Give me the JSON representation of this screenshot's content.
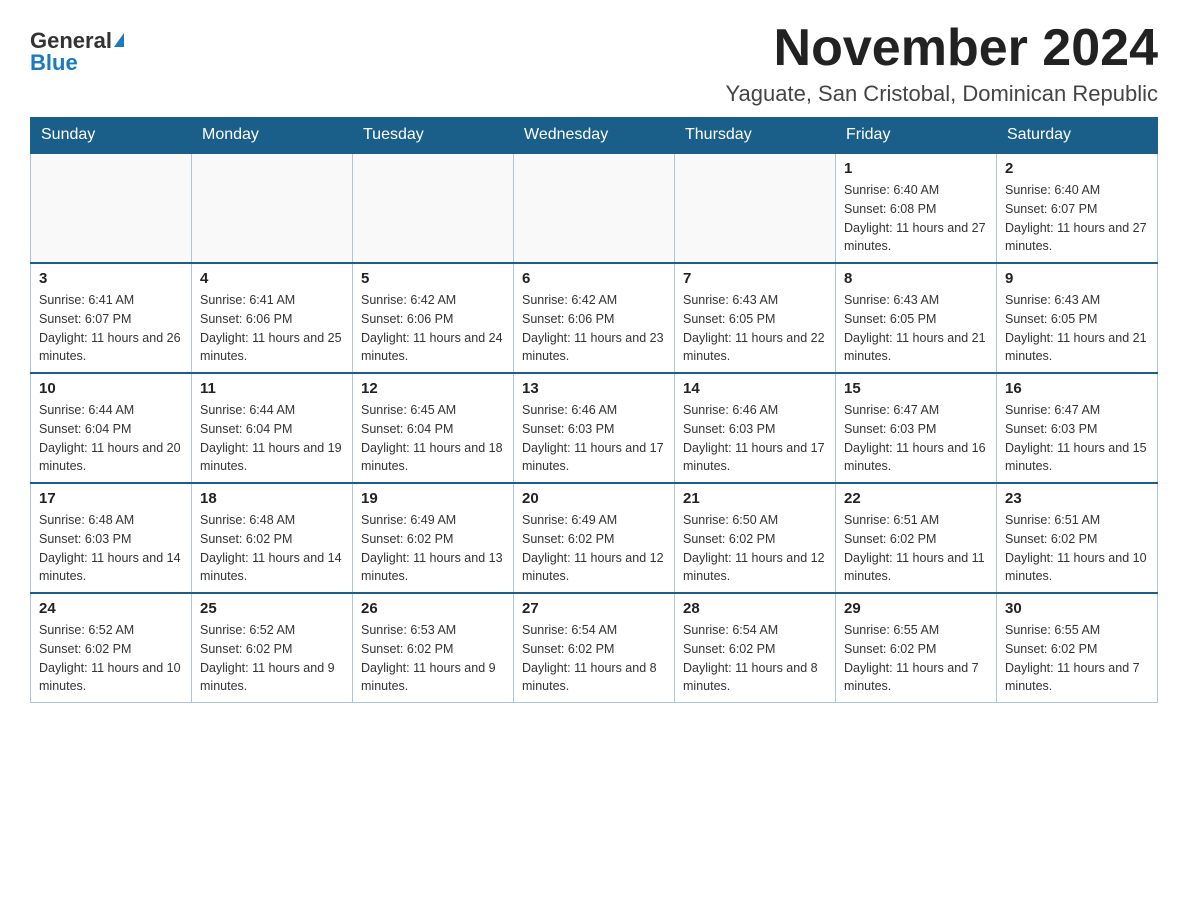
{
  "header": {
    "logo_general": "General",
    "logo_blue": "Blue",
    "month_title": "November 2024",
    "location": "Yaguate, San Cristobal, Dominican Republic"
  },
  "days_of_week": [
    "Sunday",
    "Monday",
    "Tuesday",
    "Wednesday",
    "Thursday",
    "Friday",
    "Saturday"
  ],
  "weeks": [
    [
      {
        "day": "",
        "info": ""
      },
      {
        "day": "",
        "info": ""
      },
      {
        "day": "",
        "info": ""
      },
      {
        "day": "",
        "info": ""
      },
      {
        "day": "",
        "info": ""
      },
      {
        "day": "1",
        "info": "Sunrise: 6:40 AM\nSunset: 6:08 PM\nDaylight: 11 hours and 27 minutes."
      },
      {
        "day": "2",
        "info": "Sunrise: 6:40 AM\nSunset: 6:07 PM\nDaylight: 11 hours and 27 minutes."
      }
    ],
    [
      {
        "day": "3",
        "info": "Sunrise: 6:41 AM\nSunset: 6:07 PM\nDaylight: 11 hours and 26 minutes."
      },
      {
        "day": "4",
        "info": "Sunrise: 6:41 AM\nSunset: 6:06 PM\nDaylight: 11 hours and 25 minutes."
      },
      {
        "day": "5",
        "info": "Sunrise: 6:42 AM\nSunset: 6:06 PM\nDaylight: 11 hours and 24 minutes."
      },
      {
        "day": "6",
        "info": "Sunrise: 6:42 AM\nSunset: 6:06 PM\nDaylight: 11 hours and 23 minutes."
      },
      {
        "day": "7",
        "info": "Sunrise: 6:43 AM\nSunset: 6:05 PM\nDaylight: 11 hours and 22 minutes."
      },
      {
        "day": "8",
        "info": "Sunrise: 6:43 AM\nSunset: 6:05 PM\nDaylight: 11 hours and 21 minutes."
      },
      {
        "day": "9",
        "info": "Sunrise: 6:43 AM\nSunset: 6:05 PM\nDaylight: 11 hours and 21 minutes."
      }
    ],
    [
      {
        "day": "10",
        "info": "Sunrise: 6:44 AM\nSunset: 6:04 PM\nDaylight: 11 hours and 20 minutes."
      },
      {
        "day": "11",
        "info": "Sunrise: 6:44 AM\nSunset: 6:04 PM\nDaylight: 11 hours and 19 minutes."
      },
      {
        "day": "12",
        "info": "Sunrise: 6:45 AM\nSunset: 6:04 PM\nDaylight: 11 hours and 18 minutes."
      },
      {
        "day": "13",
        "info": "Sunrise: 6:46 AM\nSunset: 6:03 PM\nDaylight: 11 hours and 17 minutes."
      },
      {
        "day": "14",
        "info": "Sunrise: 6:46 AM\nSunset: 6:03 PM\nDaylight: 11 hours and 17 minutes."
      },
      {
        "day": "15",
        "info": "Sunrise: 6:47 AM\nSunset: 6:03 PM\nDaylight: 11 hours and 16 minutes."
      },
      {
        "day": "16",
        "info": "Sunrise: 6:47 AM\nSunset: 6:03 PM\nDaylight: 11 hours and 15 minutes."
      }
    ],
    [
      {
        "day": "17",
        "info": "Sunrise: 6:48 AM\nSunset: 6:03 PM\nDaylight: 11 hours and 14 minutes."
      },
      {
        "day": "18",
        "info": "Sunrise: 6:48 AM\nSunset: 6:02 PM\nDaylight: 11 hours and 14 minutes."
      },
      {
        "day": "19",
        "info": "Sunrise: 6:49 AM\nSunset: 6:02 PM\nDaylight: 11 hours and 13 minutes."
      },
      {
        "day": "20",
        "info": "Sunrise: 6:49 AM\nSunset: 6:02 PM\nDaylight: 11 hours and 12 minutes."
      },
      {
        "day": "21",
        "info": "Sunrise: 6:50 AM\nSunset: 6:02 PM\nDaylight: 11 hours and 12 minutes."
      },
      {
        "day": "22",
        "info": "Sunrise: 6:51 AM\nSunset: 6:02 PM\nDaylight: 11 hours and 11 minutes."
      },
      {
        "day": "23",
        "info": "Sunrise: 6:51 AM\nSunset: 6:02 PM\nDaylight: 11 hours and 10 minutes."
      }
    ],
    [
      {
        "day": "24",
        "info": "Sunrise: 6:52 AM\nSunset: 6:02 PM\nDaylight: 11 hours and 10 minutes."
      },
      {
        "day": "25",
        "info": "Sunrise: 6:52 AM\nSunset: 6:02 PM\nDaylight: 11 hours and 9 minutes."
      },
      {
        "day": "26",
        "info": "Sunrise: 6:53 AM\nSunset: 6:02 PM\nDaylight: 11 hours and 9 minutes."
      },
      {
        "day": "27",
        "info": "Sunrise: 6:54 AM\nSunset: 6:02 PM\nDaylight: 11 hours and 8 minutes."
      },
      {
        "day": "28",
        "info": "Sunrise: 6:54 AM\nSunset: 6:02 PM\nDaylight: 11 hours and 8 minutes."
      },
      {
        "day": "29",
        "info": "Sunrise: 6:55 AM\nSunset: 6:02 PM\nDaylight: 11 hours and 7 minutes."
      },
      {
        "day": "30",
        "info": "Sunrise: 6:55 AM\nSunset: 6:02 PM\nDaylight: 11 hours and 7 minutes."
      }
    ]
  ]
}
